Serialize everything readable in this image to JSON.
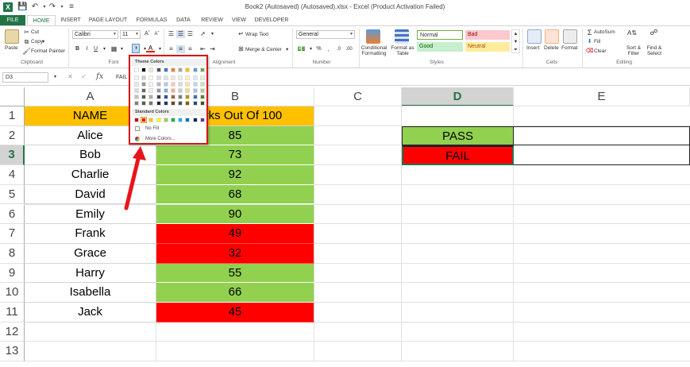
{
  "window": {
    "title": "Book2 (Autosaved) (Autosaved).xlsx - Excel (Product Activation Failed)"
  },
  "tabs": [
    "FILE",
    "HOME",
    "INSERT",
    "PAGE LAYOUT",
    "FORMULAS",
    "DATA",
    "REVIEW",
    "VIEW",
    "DEVELOPER"
  ],
  "ribbon": {
    "clipboard": {
      "label": "Clipboard",
      "paste": "Paste",
      "cut": "Cut",
      "copy": "Copy",
      "format_painter": "Format Painter"
    },
    "font": {
      "label": "Font",
      "name": "Calibri",
      "size": "11"
    },
    "alignment": {
      "label": "Alignment",
      "wrap_text": "Wrap Text",
      "merge_center": "Merge & Center"
    },
    "number": {
      "label": "Number",
      "format": "General"
    },
    "styles": {
      "label": "Styles",
      "conditional_formatting": "Conditional Formatting",
      "format_as_table": "Format as Table",
      "normal": "Normal",
      "bad": "Bad",
      "good": "Good",
      "neutral": "Neutral"
    },
    "cells": {
      "label": "Cells",
      "insert": "Insert",
      "delete": "Delete",
      "format": "Format"
    },
    "editing": {
      "label": "Editing",
      "autosum": "AutoSum",
      "fill": "Fill",
      "clear": "Clear",
      "sort_filter": "Sort & Filter",
      "find_select": "Find & Select"
    }
  },
  "formula_bar": {
    "name_box": "D3",
    "content": "FAIL"
  },
  "color_popup": {
    "theme_heading": "Theme Colors",
    "standard_heading": "Standard Colors",
    "no_fill": "No Fill",
    "more_colors": "More Colors...",
    "theme_top_row": [
      "#ffffff",
      "#000000",
      "#e7e6e6",
      "#44546a",
      "#4472c4",
      "#ed7d31",
      "#a5a5a5",
      "#ffc000",
      "#5b9bd5",
      "#70ad47"
    ],
    "standard_colors": [
      "#c00000",
      "#ff0000",
      "#ffc000",
      "#ffff00",
      "#92d050",
      "#00b050",
      "#00b0f0",
      "#0070c0",
      "#002060",
      "#7030a0"
    ]
  },
  "sheet": {
    "columns": [
      "A",
      "B",
      "C",
      "D",
      "E"
    ],
    "rows": [
      "1",
      "2",
      "3",
      "4",
      "5",
      "6",
      "7",
      "8",
      "9",
      "10",
      "11",
      "12",
      "13"
    ],
    "header_row": {
      "a": "NAME",
      "b": "Marks Out Of 100"
    },
    "data": [
      {
        "name": "Alice",
        "marks": "85",
        "status": "pass"
      },
      {
        "name": "Bob",
        "marks": "73",
        "status": "pass"
      },
      {
        "name": "Charlie",
        "marks": "92",
        "status": "pass"
      },
      {
        "name": "David",
        "marks": "68",
        "status": "pass"
      },
      {
        "name": "Emily",
        "marks": "90",
        "status": "pass"
      },
      {
        "name": "Frank",
        "marks": "49",
        "status": "fail"
      },
      {
        "name": "Grace",
        "marks": "32",
        "status": "fail"
      },
      {
        "name": "Harry",
        "marks": "55",
        "status": "pass"
      },
      {
        "name": "Isabella",
        "marks": "66",
        "status": "pass"
      },
      {
        "name": "Jack",
        "marks": "45",
        "status": "fail"
      }
    ],
    "d2": "PASS",
    "d3": "FAIL",
    "active_cell": "D3"
  },
  "colors": {
    "header_fill": "#ffc000",
    "pass_fill": "#92d050",
    "fail_fill": "#ff0000",
    "excel_green": "#217346"
  }
}
